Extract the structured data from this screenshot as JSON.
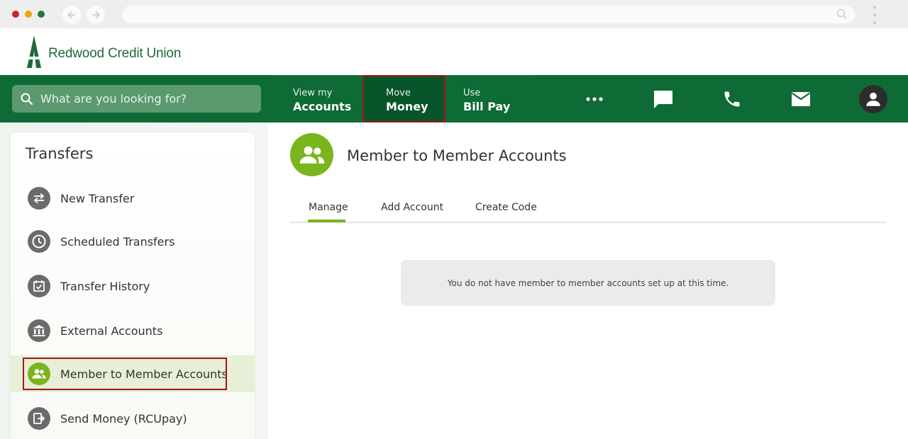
{
  "brand": {
    "name": "Redwood Credit Union",
    "green": "#0e6b35",
    "accent": "#7ab51d",
    "highlight": "#a8121a"
  },
  "search": {
    "placeholder": "What are you looking for?"
  },
  "nav": {
    "accounts": {
      "small": "View my",
      "big": "Accounts"
    },
    "move_money": {
      "small": "Move",
      "big": "Money"
    },
    "bill_pay": {
      "small": "Use",
      "big": "Bill Pay"
    },
    "icons": [
      "more-icon",
      "chat-icon",
      "phone-icon",
      "mail-icon",
      "profile-icon"
    ]
  },
  "sidebar": {
    "title": "Transfers",
    "items": [
      {
        "label": "New Transfer",
        "icon": "transfer-arrows-icon"
      },
      {
        "label": "Scheduled Transfers",
        "icon": "clock-icon"
      },
      {
        "label": "Transfer History",
        "icon": "calendar-check-icon"
      },
      {
        "label": "External Accounts",
        "icon": "bank-icon"
      },
      {
        "label": "Member to Member Accounts",
        "icon": "people-icon",
        "active": true
      },
      {
        "label": "Send Money (RCUpay)",
        "icon": "send-money-icon"
      }
    ]
  },
  "main": {
    "title": "Member to Member Accounts",
    "tabs": [
      {
        "label": "Manage",
        "active": true
      },
      {
        "label": "Add Account"
      },
      {
        "label": "Create Code"
      }
    ],
    "empty_message": "You do not have member to member accounts set up at this time."
  }
}
